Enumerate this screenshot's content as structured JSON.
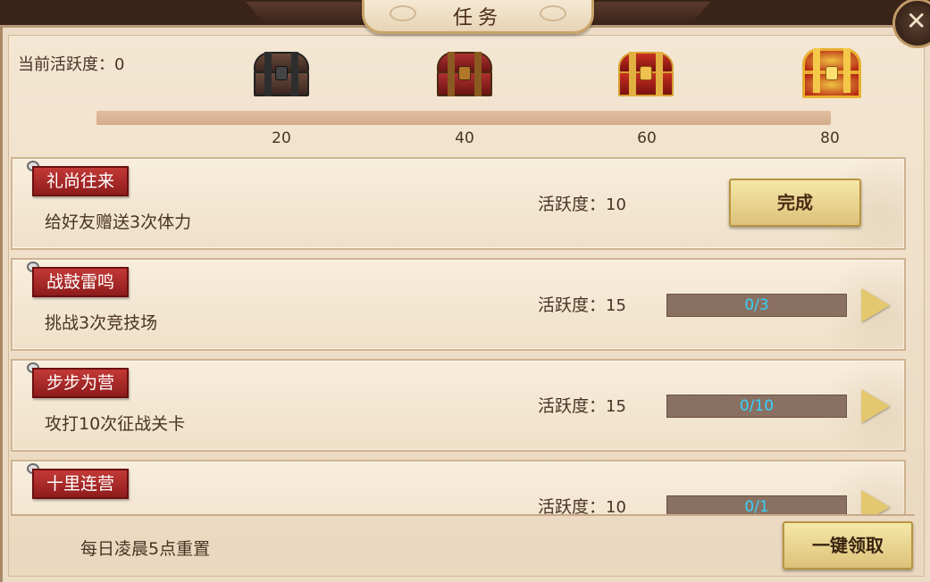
{
  "window": {
    "title": "任务",
    "close_glyph": "✕"
  },
  "activity": {
    "label": "当前活跃度：",
    "current": "0",
    "progress_fraction": 0,
    "milestones": [
      {
        "value": "20",
        "chest": "iron-chest-icon"
      },
      {
        "value": "40",
        "chest": "bronze-chest-icon"
      },
      {
        "value": "60",
        "chest": "gold-chest-icon"
      },
      {
        "value": "80",
        "chest": "dragon-chest-icon"
      }
    ]
  },
  "tasks": [
    {
      "tag": "礼尚往来",
      "desc": "给好友赠送3次体力",
      "points_label": "活跃度：",
      "points": "10",
      "state": "complete",
      "button_label": "完成"
    },
    {
      "tag": "战鼓雷鸣",
      "desc": "挑战3次竞技场",
      "points_label": "活跃度：",
      "points": "15",
      "state": "progress",
      "progress": "0/3"
    },
    {
      "tag": "步步为营",
      "desc": "攻打10次征战关卡",
      "points_label": "活跃度：",
      "points": "15",
      "state": "progress",
      "progress": "0/10"
    },
    {
      "tag": "十里连营",
      "desc": "",
      "points_label": "活跃度：",
      "points": "10",
      "state": "progress",
      "progress": "0/1"
    }
  ],
  "footer": {
    "note": "每日凌晨5点重置",
    "claim_all_label": "一键领取"
  },
  "colors": {
    "tag_red": "#b3302c",
    "progress_text": "#36d2ff",
    "button_gold": "#e8d290"
  }
}
